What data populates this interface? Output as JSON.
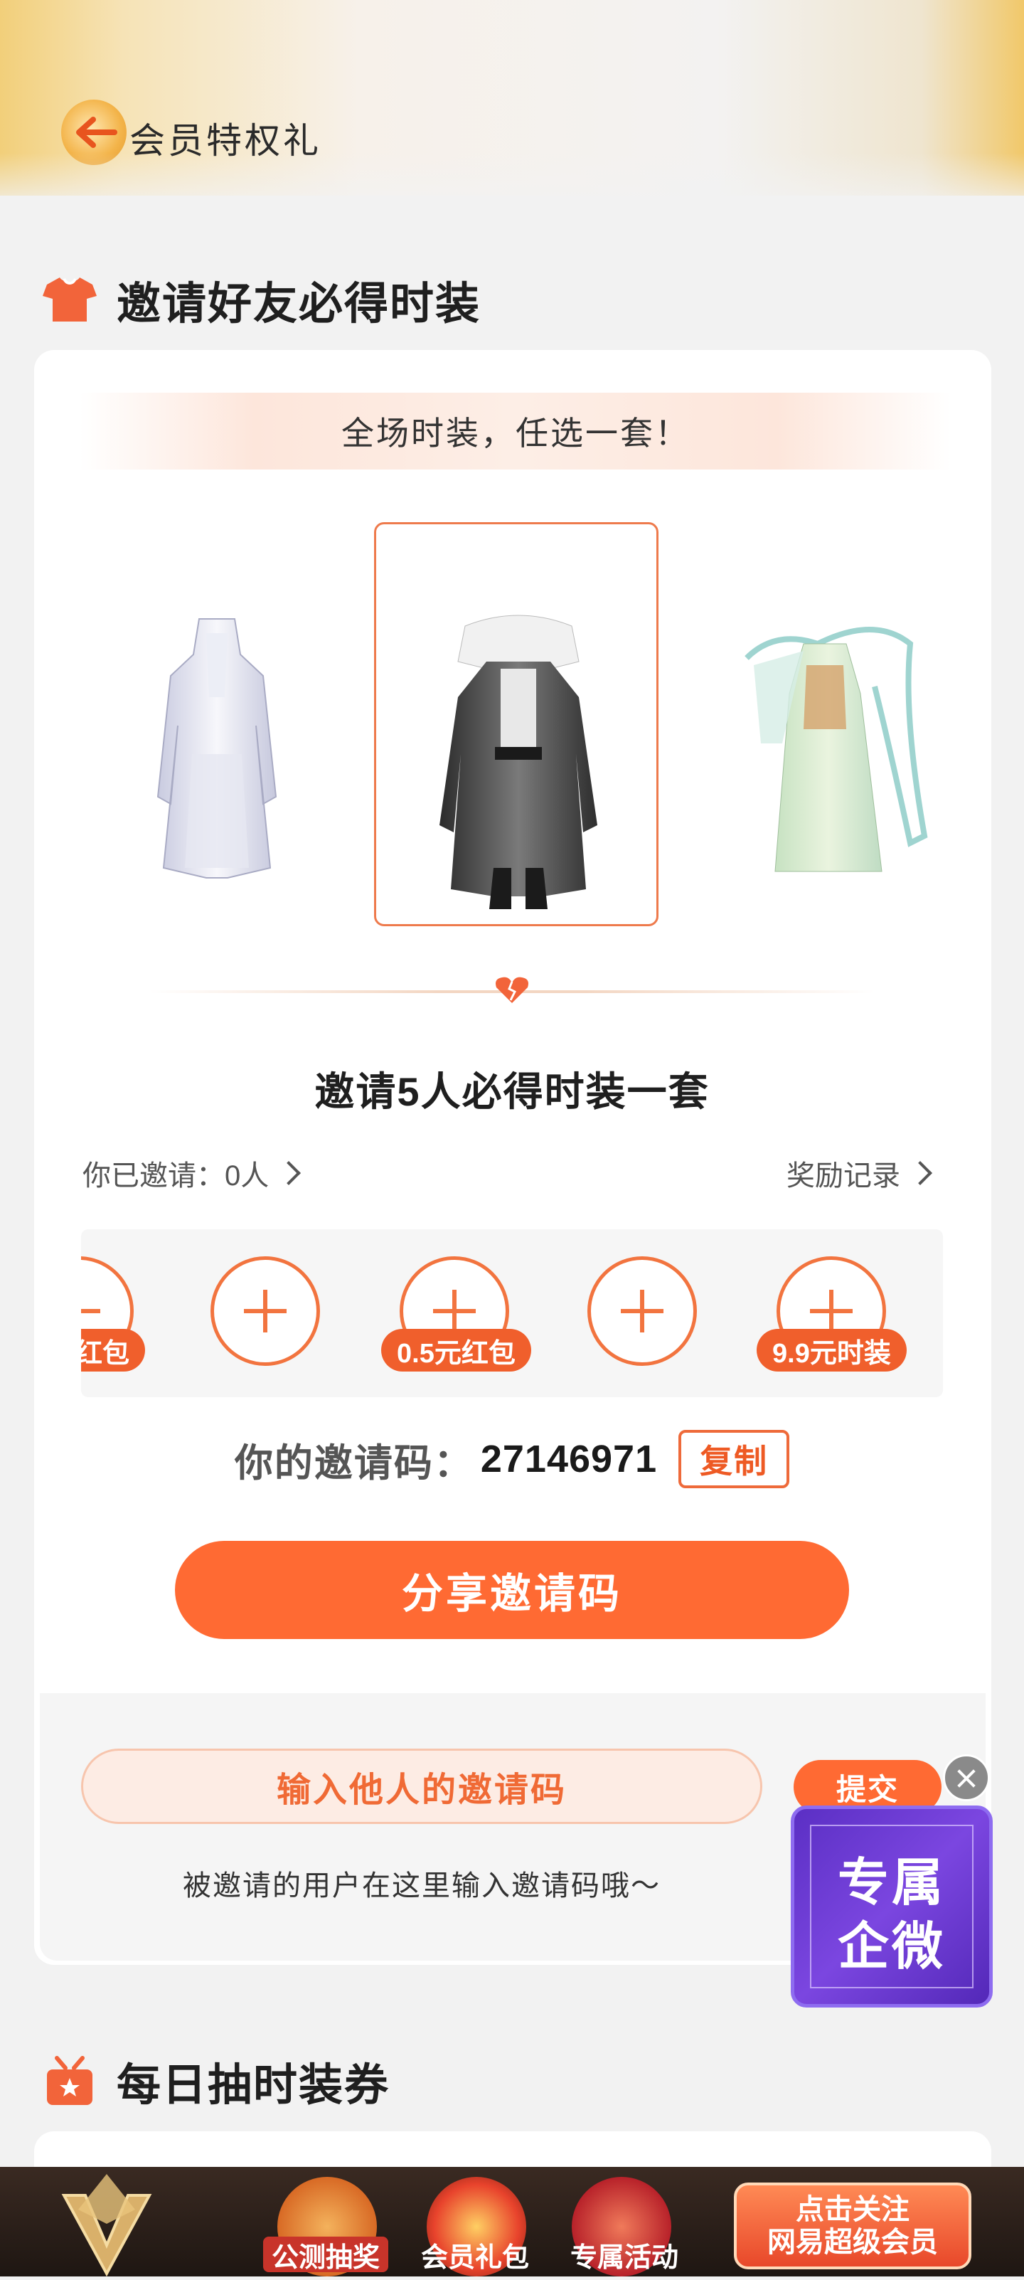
{
  "header": {
    "title": "会员特权礼"
  },
  "section1": {
    "title": "邀请好友必得时装",
    "banner": "全场时装，任选一套！",
    "outfits": [
      "white-robe",
      "black-robe",
      "green-robe"
    ],
    "invite_title": "邀请5人必得时装一套",
    "invited_label": "你已邀请：0人",
    "reward_link": "奖励记录",
    "slots": [
      {
        "badge": "红包"
      },
      {
        "badge": ""
      },
      {
        "badge": "0.5元红包"
      },
      {
        "badge": ""
      },
      {
        "badge": "9.9元时装"
      }
    ],
    "code_label": "你的邀请码：",
    "code_value": "27146971",
    "copy_label": "复制",
    "share_label": "分享邀请码",
    "input_placeholder": "输入他人的邀请码",
    "submit_label": "提交",
    "input_hint": "被邀请的用户在这里输入邀请码哦～"
  },
  "float_widget": {
    "line1": "专属",
    "line2": "企微"
  },
  "section2": {
    "title": "每日抽时装券"
  },
  "bottom_bar": {
    "items": [
      {
        "label": "公测抽奖"
      },
      {
        "label": "会员礼包"
      },
      {
        "label": "专属活动"
      }
    ],
    "follow_line1": "点击关注",
    "follow_line2": "网易超级会员"
  },
  "colors": {
    "accent": "#ff6a33",
    "badge": "#f05f2c",
    "outline": "#f2743f",
    "widget": "#6a3bd4"
  }
}
